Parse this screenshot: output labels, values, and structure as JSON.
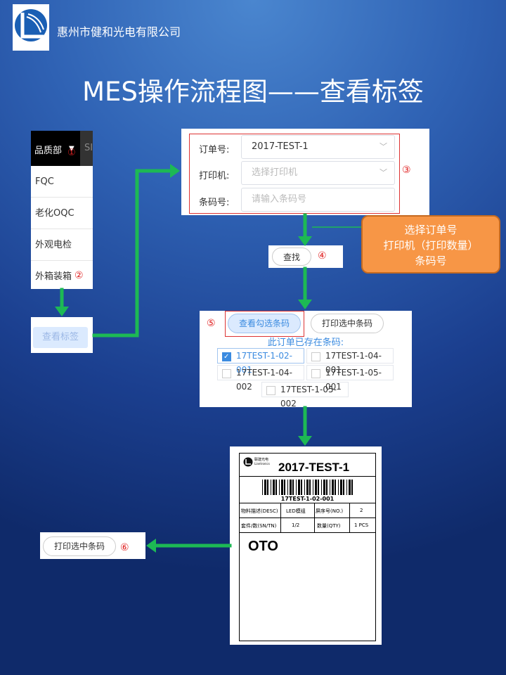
{
  "header": {
    "company": "惠州市健和光电有限公司",
    "title": "MES操作流程图——查看标签"
  },
  "step1": {
    "dept_label": "品质部",
    "cut_tab": "SI",
    "marker": "①",
    "menu": [
      "FQC",
      "老化OQC",
      "外观电检",
      "外箱装箱"
    ],
    "marker2": "②",
    "view_label_button": "查看标签"
  },
  "step3": {
    "marker": "③",
    "order_label": "订单号:",
    "order_value": "2017-TEST-1",
    "printer_label": "打印机:",
    "printer_placeholder": "选择打印机",
    "barcode_label": "条码号:",
    "barcode_placeholder": "请输入条码号"
  },
  "note": {
    "line1": "选择订单号",
    "line2": "打印机（打印数量）",
    "line3": "条码号"
  },
  "step4": {
    "find_button": "查找",
    "marker": "④"
  },
  "step5": {
    "marker": "⑤",
    "view_checked": "查看勾选条码",
    "print_selected": "打印选中条码",
    "exist_text": "此订单已存在条码:",
    "codes": [
      {
        "code": "17TEST-1-02-001",
        "checked": true
      },
      {
        "code": "17TEST-1-04-001",
        "checked": false
      },
      {
        "code": "17TEST-1-04-002",
        "checked": false
      },
      {
        "code": "17TEST-1-05-001",
        "checked": false
      },
      {
        "code": "17TEST-1-05-002",
        "checked": false
      }
    ]
  },
  "label": {
    "brand": "联建光电",
    "brand_en": "Liantronics",
    "order": "2017-TEST-1",
    "barcode_text": "17TEST-1-02-001",
    "desc_label": "物料描述(DESC)",
    "desc_value": "LED模组",
    "no_label": "屏序号(NO.)",
    "no_value": "2",
    "sn_label": "套件/数(SN/TN)",
    "sn_value": "1/2",
    "qty_label": "数量(QTY)",
    "qty_value": "1 PCS",
    "big_text": "OTO"
  },
  "step6": {
    "print_button": "打印选中条码",
    "marker": "⑥"
  },
  "colors": {
    "arrow": "#1db954",
    "accent_blue": "#3b8be0",
    "note_orange": "#f79646",
    "marker_red": "#e02020"
  }
}
